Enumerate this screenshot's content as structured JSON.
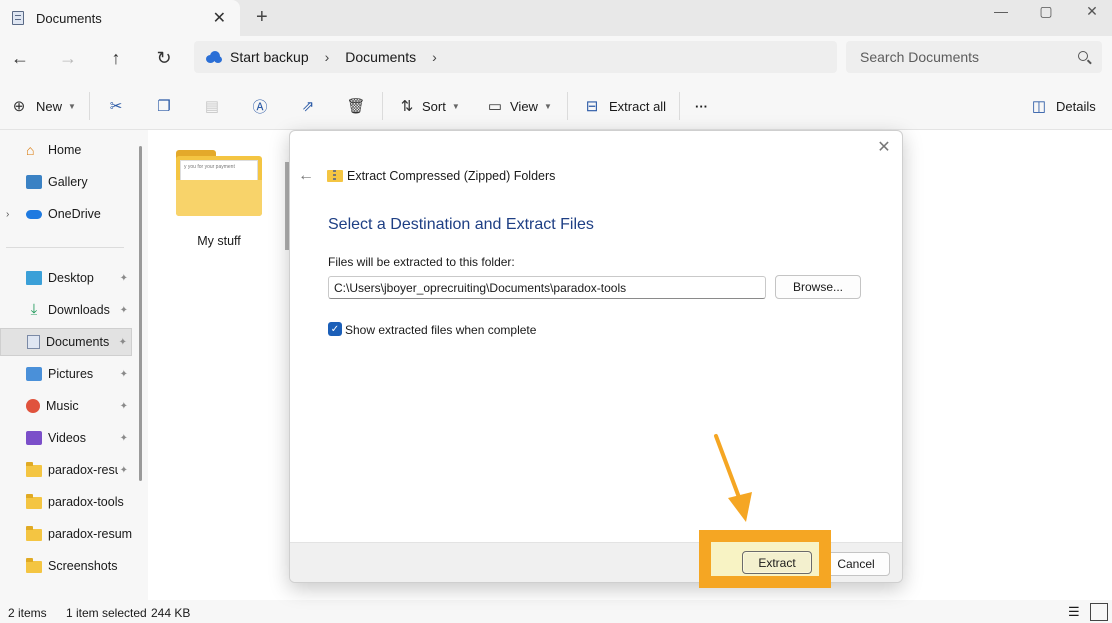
{
  "window": {
    "tab_title": "Documents",
    "tab_close": "✕",
    "new_tab": "+",
    "minimize": "—",
    "maximize": "▢",
    "close": "✕"
  },
  "nav": {
    "back": "←",
    "forward": "→",
    "up": "↑",
    "refresh": "↻"
  },
  "breadcrumb": {
    "items": [
      "Start backup",
      "Documents"
    ],
    "separator": "›"
  },
  "search": {
    "placeholder": "Search Documents"
  },
  "toolbar": {
    "new_label": "New",
    "sort_label": "Sort",
    "view_label": "View",
    "extract_all_label": "Extract all",
    "more_label": "···",
    "details_label": "Details"
  },
  "sidebar": {
    "items": [
      {
        "label": "Home",
        "icon": "home-icon"
      },
      {
        "label": "Gallery",
        "icon": "gallery-icon"
      },
      {
        "label": "OneDrive",
        "icon": "onedrive-icon"
      },
      {
        "label": "Desktop",
        "icon": "desktop-icon",
        "pinned": true
      },
      {
        "label": "Downloads",
        "icon": "download-icon",
        "pinned": true
      },
      {
        "label": "Documents",
        "icon": "documents-icon",
        "pinned": true,
        "selected": true
      },
      {
        "label": "Pictures",
        "icon": "pictures-icon",
        "pinned": true
      },
      {
        "label": "Music",
        "icon": "music-icon",
        "pinned": true
      },
      {
        "label": "Videos",
        "icon": "videos-icon",
        "pinned": true
      },
      {
        "label": "paradox-resu",
        "icon": "folder-icon",
        "pinned": true
      },
      {
        "label": "paradox-tools",
        "icon": "folder-icon"
      },
      {
        "label": "paradox-resume",
        "icon": "folder-icon"
      },
      {
        "label": "Screenshots",
        "icon": "folder-icon"
      }
    ],
    "pin_glyph": "📌",
    "expand_glyph": "›"
  },
  "content": {
    "folder_label": "My stuff",
    "folder_preview_text": "y you for your payment"
  },
  "status": {
    "item_count": "2 items",
    "selection": "1 item selected",
    "size": "244 KB"
  },
  "dialog": {
    "title": "Extract Compressed (Zipped) Folders",
    "heading": "Select a Destination and Extract Files",
    "path_label": "Files will be extracted to this folder:",
    "path_value": "C:\\Users\\jboyer_oprecruiting\\Documents\\paradox-tools",
    "browse_label": "Browse...",
    "checkbox_label": "Show extracted files when complete",
    "checkbox_checked": true,
    "extract_label": "Extract",
    "cancel_label": "Cancel",
    "close_glyph": "✕",
    "back_glyph": "←"
  },
  "colors": {
    "accent": "#1b5fb8",
    "heading": "#1e3f84",
    "annotation": "#f5a623",
    "folder": "#f4c542"
  }
}
